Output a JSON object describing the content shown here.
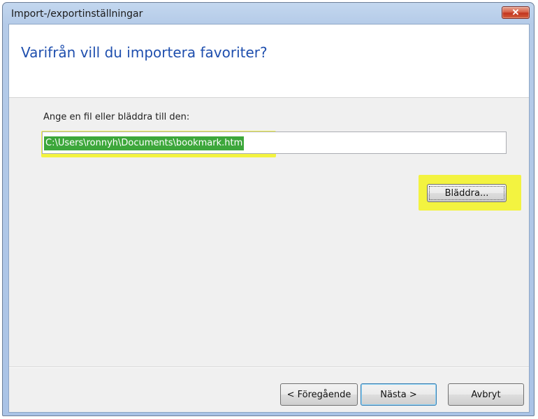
{
  "window": {
    "title": "Import-/exportinställningar",
    "close_glyph": "✕"
  },
  "wizard": {
    "heading": "Varifrån vill du importera favoriter?",
    "file_label": "Ange en fil eller bläddra till den:",
    "file_path_value": "C:\\Users\\ronnyh\\Documents\\bookmark.htm",
    "browse_label": "Bläddra..."
  },
  "footer": {
    "back_label": "< Föregående",
    "next_label": "Nästa >",
    "cancel_label": "Avbryt"
  },
  "colors": {
    "heading": "#1f4fae",
    "annotation_highlight": "#f3f340",
    "selection": "#3da73b"
  }
}
